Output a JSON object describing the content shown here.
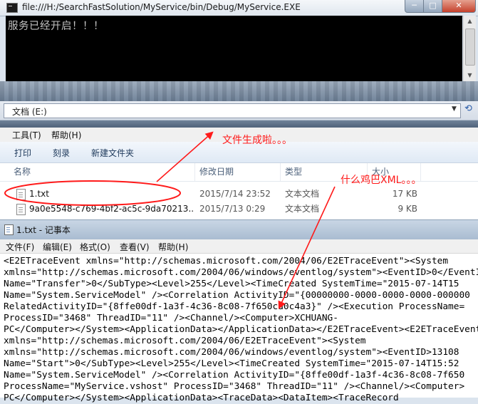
{
  "console": {
    "title": "file:///H:/SearchFastSolution/MyService/bin/Debug/MyService.EXE",
    "output": "服务已经开启！！！",
    "controls": {
      "minimize": "─",
      "maximize": "□",
      "close": "✕"
    }
  },
  "explorer": {
    "address": "文档 (E:)",
    "menu": [
      "工具(T)",
      "帮助(H)"
    ],
    "toolbar": [
      "打印",
      "刻录",
      "新建文件夹"
    ],
    "columns": [
      "名称",
      "修改日期",
      "类型",
      "大小"
    ],
    "files": [
      {
        "name": "1.txt",
        "modified": "2015/7/14 23:52",
        "type": "文本文档",
        "size": "17 KB"
      },
      {
        "name": "9a0e5548-c769-4bf2-ac5c-9da70213...",
        "modified": "2015/7/13 0:29",
        "type": "文本文档",
        "size": "9 KB"
      }
    ]
  },
  "notepad": {
    "title": "1.txt - 记事本",
    "menu": [
      "文件(F)",
      "编辑(E)",
      "格式(O)",
      "查看(V)",
      "帮助(H)"
    ],
    "lines": [
      "<E2ETraceEvent xmlns=\"http://schemas.microsoft.com/2004/06/E2ETraceEvent\"><System",
      "xmlns=\"http://schemas.microsoft.com/2004/06/windows/eventlog/system\"><EventID>0</EventID>",
      "Name=\"Transfer\">0</SubType><Level>255</Level><TimeCreated SystemTime=\"2015-07-14T15",
      "Name=\"System.ServiceModel\" /><Correlation ActivityID=\"{00000000-0000-0000-0000-000000",
      "RelatedActivityID=\"{8ffe00df-1a3f-4c36-8c08-7f650cd0c4a3}\" /><Execution ProcessName=",
      "ProcessID=\"3468\" ThreadID=\"11\" /><Channel/><Computer>XCHUANG-",
      "PC</Computer></System><ApplicationData></ApplicationData></E2ETraceEvent><E2ETraceEvent",
      "xmlns=\"http://schemas.microsoft.com/2004/06/E2ETraceEvent\"><System",
      "xmlns=\"http://schemas.microsoft.com/2004/06/windows/eventlog/system\"><EventID>13108",
      "Name=\"Start\">0</SubType><Level>255</Level><TimeCreated SystemTime=\"2015-07-14T15:52",
      "Name=\"System.ServiceModel\" /><Correlation ActivityID=\"{8ffe00df-1a3f-4c36-8c08-7f650",
      "ProcessName=\"MyService.vshost\" ProcessID=\"3468\" ThreadID=\"11\" /><Channel/><Computer>",
      "PC</Computer></System><ApplicationData><TraceData><DataItem><TraceRecord"
    ]
  },
  "annotations": {
    "file_created": "文件生成啦。。。",
    "what_xml": "什么鸡巴XML。。。"
  },
  "colors": {
    "annotation": "#ff1a1a",
    "console_bg": "#000000",
    "console_fg": "#c0c0c0"
  }
}
